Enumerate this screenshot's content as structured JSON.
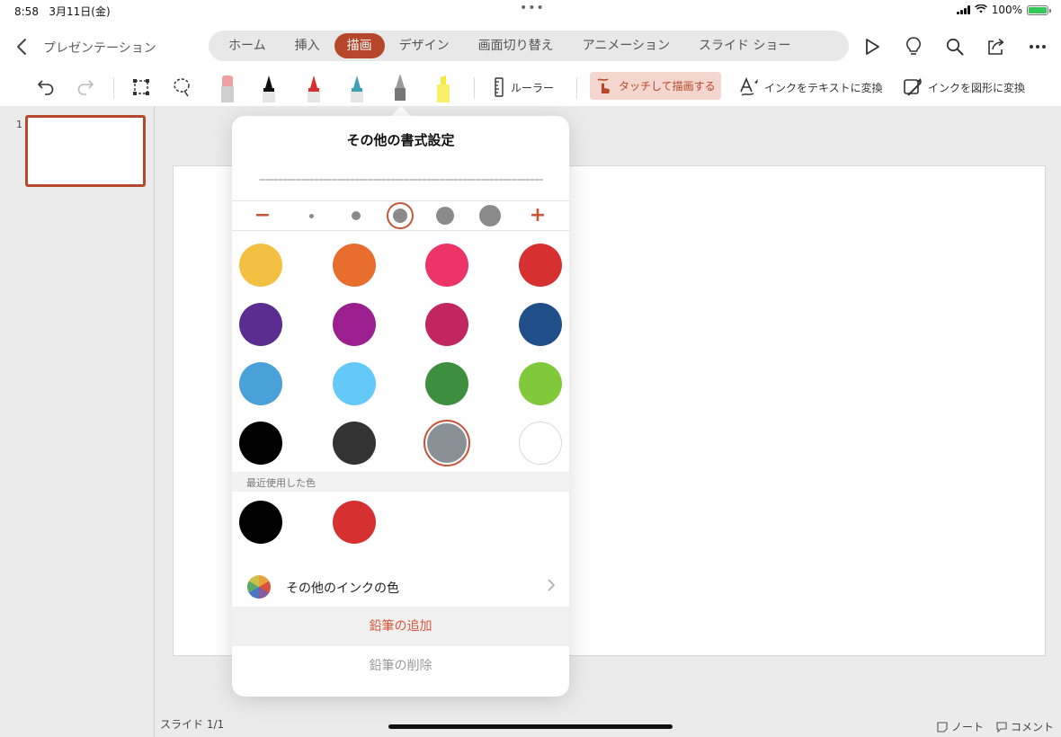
{
  "status_bar": {
    "time": "8:58",
    "date": "3月11日(金)",
    "battery": "100%"
  },
  "app": {
    "back_label": "",
    "title": "プレゼンテーション"
  },
  "tabs": [
    {
      "label": "ホーム"
    },
    {
      "label": "挿入"
    },
    {
      "label": "描画",
      "active": true
    },
    {
      "label": "デザイン"
    },
    {
      "label": "画面切り替え"
    },
    {
      "label": "アニメーション"
    },
    {
      "label": "スライド ショー"
    }
  ],
  "ribbon": {
    "ruler_label": "ルーラー",
    "touch_draw_label": "タッチして描画する",
    "ink_to_text_label": "インクをテキストに変換",
    "ink_to_shape_label": "インクを図形に変換"
  },
  "thumbnails": {
    "slide_number": "1"
  },
  "footer": {
    "slide_count": "スライド 1/1",
    "notes_label": "ノート",
    "comments_label": "コメント"
  },
  "popover": {
    "title": "その他の書式設定",
    "stroke_sizes": 5,
    "selected_size_index": 2,
    "colors": [
      "#f4c042",
      "#e76e2f",
      "#ec3468",
      "#d63030",
      "#5b2d91",
      "#9c1f8f",
      "#c12660",
      "#1f4e89",
      "#4aa0d8",
      "#64c8f8",
      "#3d8e3f",
      "#80c93b",
      "#000000",
      "#333333",
      "#8a9196",
      "#ffffff"
    ],
    "selected_color": "#8a9196",
    "recent_header": "最近使用した色",
    "recent_colors": [
      "#000000",
      "#d63030"
    ],
    "more_colors_label": "その他のインクの色",
    "add_pencil_label": "鉛筆の追加",
    "delete_pencil_label": "鉛筆の削除"
  },
  "accent_color": "#b7472a"
}
